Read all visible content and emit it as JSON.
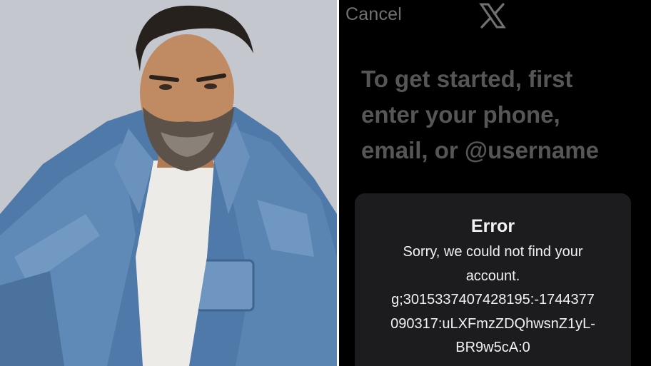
{
  "colors": {
    "background": "#000000",
    "muted_text": "#6a6a6a",
    "cancel_text": "#8a8a8a",
    "alert_background": "#1c1c1e",
    "alert_text": "#f2f2f2"
  },
  "photo": {
    "icon": "portrait-photo",
    "subject": "man-in-denim-jacket"
  },
  "app": {
    "cancel_label": "Cancel",
    "logo_icon": "x-logo-icon",
    "headline": "To get started, first enter your phone, email, or @username"
  },
  "alert": {
    "title": "Error",
    "message_lines": [
      "Sorry, we could not find your",
      "account.",
      "g;3015337407428195:-1744377",
      "090317:uLXFmzZDQhwsnZ1yL-",
      "BR9w5cA:0"
    ]
  }
}
